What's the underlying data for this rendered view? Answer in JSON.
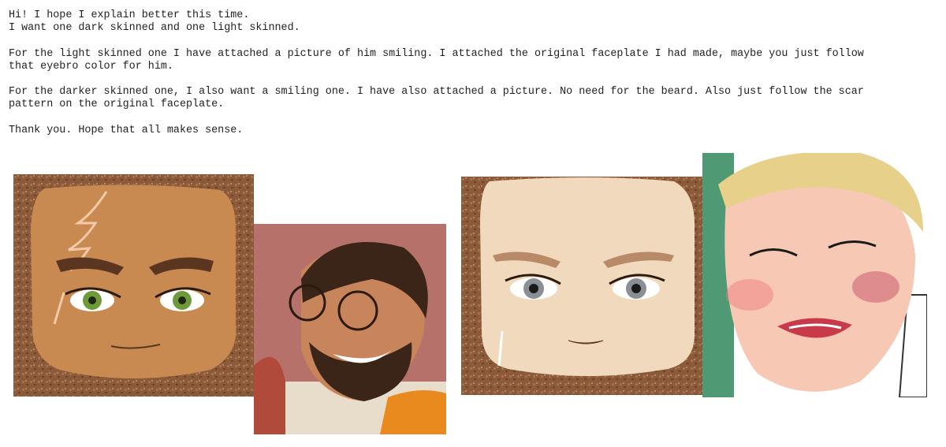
{
  "message": {
    "paragraphs": [
      "Hi! I hope I explain better this time.\nI want one dark skinned and one light skinned.",
      "For the light skinned one I have attached a picture of him smiling. I attached the original faceplate I had made, maybe you just follow\nthat eyebro color for him.",
      "For the darker skinned one, I also want a smiling one. I have also attached a picture. No need for the beard. Also just follow the scar\npattern on the original faceplate.",
      "Thank you. Hope that all makes sense."
    ]
  },
  "colors": {
    "dark_skin": "#c98a52",
    "light_skin": "#f0d9bd",
    "cork_bg": "#8a5a3a",
    "green_iris": "#6f9a3a",
    "grey_iris": "#8a8f95",
    "blond_hair": "#e6d08a",
    "orange_shirt": "#e98a1e"
  }
}
